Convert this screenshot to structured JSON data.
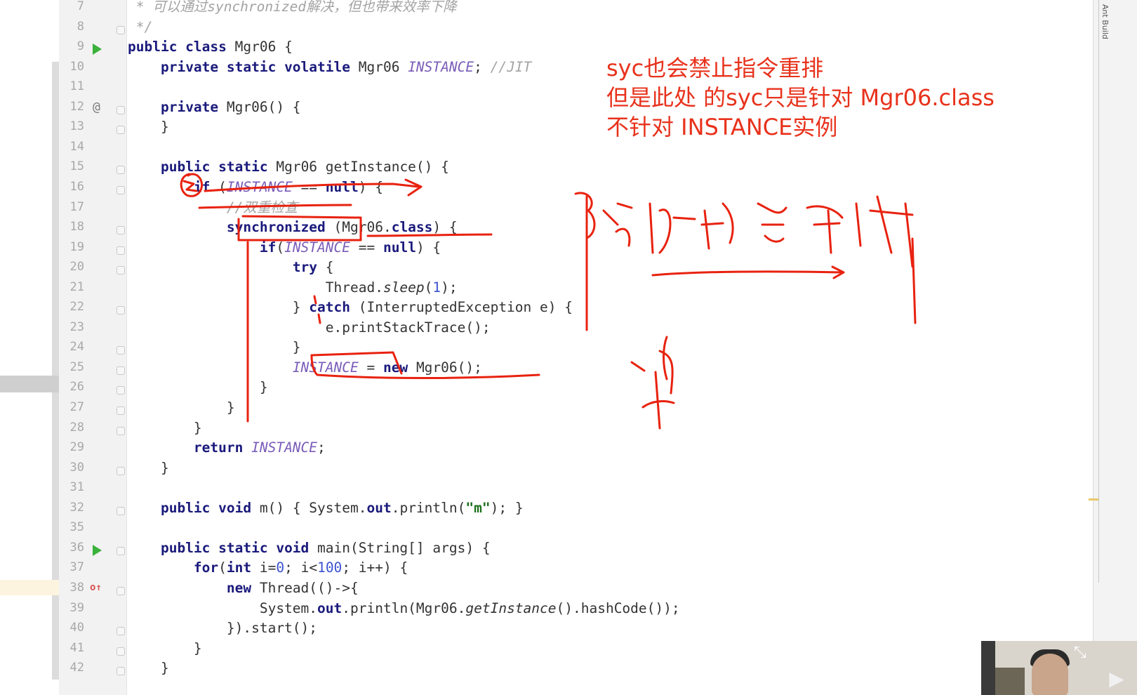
{
  "editor": {
    "lines": [
      {
        "n": "7",
        "segs": [
          [
            "cmt",
            " * 可以通过synchronized解决，但也带来效率下降"
          ]
        ]
      },
      {
        "n": "8",
        "segs": [
          [
            "cmt",
            " */"
          ]
        ]
      },
      {
        "n": "9",
        "segs": [
          [
            "kw",
            "public class "
          ],
          [
            "",
            "Mgr06 {"
          ]
        ]
      },
      {
        "n": "10",
        "segs": [
          [
            "",
            "    "
          ],
          [
            "kw",
            "private static volatile "
          ],
          [
            "",
            "Mgr06 "
          ],
          [
            "inst",
            "INSTANCE"
          ],
          [
            "",
            "; "
          ],
          [
            "cmt",
            "//JIT"
          ]
        ]
      },
      {
        "n": "11",
        "segs": []
      },
      {
        "n": "12",
        "segs": [
          [
            "",
            "    "
          ],
          [
            "kw",
            "private "
          ],
          [
            "",
            "Mgr06() {"
          ]
        ]
      },
      {
        "n": "13",
        "segs": [
          [
            "",
            "    }"
          ]
        ]
      },
      {
        "n": "14",
        "segs": []
      },
      {
        "n": "15",
        "segs": [
          [
            "",
            "    "
          ],
          [
            "kw",
            "public static "
          ],
          [
            "",
            "Mgr06 getInstance() {"
          ]
        ]
      },
      {
        "n": "16",
        "segs": [
          [
            "",
            "        "
          ],
          [
            "kw",
            "if "
          ],
          [
            "",
            "("
          ],
          [
            "inst",
            "INSTANCE"
          ],
          [
            "",
            " == "
          ],
          [
            "kw",
            "null"
          ],
          [
            "",
            ") {"
          ]
        ]
      },
      {
        "n": "17",
        "segs": [
          [
            "cmt",
            "            //双重检查"
          ]
        ]
      },
      {
        "n": "18",
        "segs": [
          [
            "",
            "            "
          ],
          [
            "kw",
            "synchronized "
          ],
          [
            "",
            "(Mgr06."
          ],
          [
            "kw",
            "class"
          ],
          [
            "",
            ") {"
          ]
        ]
      },
      {
        "n": "19",
        "segs": [
          [
            "",
            "                "
          ],
          [
            "kw",
            "if"
          ],
          [
            "",
            "("
          ],
          [
            "inst",
            "INSTANCE"
          ],
          [
            "",
            " == "
          ],
          [
            "kw",
            "null"
          ],
          [
            "",
            ") {"
          ]
        ]
      },
      {
        "n": "20",
        "segs": [
          [
            "",
            "                    "
          ],
          [
            "kw",
            "try "
          ],
          [
            "",
            "{"
          ]
        ]
      },
      {
        "n": "21",
        "segs": [
          [
            "",
            "                        Thread."
          ],
          [
            "method-it",
            "sleep"
          ],
          [
            "",
            "("
          ],
          [
            "num",
            "1"
          ],
          [
            "",
            ");"
          ]
        ]
      },
      {
        "n": "22",
        "segs": [
          [
            "",
            "                    } "
          ],
          [
            "kw",
            "catch "
          ],
          [
            "",
            "(InterruptedException e) {"
          ]
        ]
      },
      {
        "n": "23",
        "segs": [
          [
            "",
            "                        e.printStackTrace();"
          ]
        ]
      },
      {
        "n": "24",
        "segs": [
          [
            "",
            "                    }"
          ]
        ]
      },
      {
        "n": "25",
        "segs": [
          [
            "",
            "                    "
          ],
          [
            "inst",
            "INSTANCE"
          ],
          [
            "",
            " = "
          ],
          [
            "kw",
            "new "
          ],
          [
            "",
            "Mgr06();"
          ]
        ]
      },
      {
        "n": "26",
        "segs": [
          [
            "",
            "                }"
          ]
        ]
      },
      {
        "n": "27",
        "segs": [
          [
            "",
            "            }"
          ]
        ]
      },
      {
        "n": "28",
        "segs": [
          [
            "",
            "        }"
          ]
        ]
      },
      {
        "n": "29",
        "segs": [
          [
            "",
            "        "
          ],
          [
            "kw",
            "return "
          ],
          [
            "inst",
            "INSTANCE"
          ],
          [
            "",
            ";"
          ]
        ]
      },
      {
        "n": "30",
        "segs": [
          [
            "",
            "    }"
          ]
        ]
      },
      {
        "n": "31",
        "segs": []
      },
      {
        "n": "32",
        "segs": [
          [
            "",
            "    "
          ],
          [
            "kw",
            "public void "
          ],
          [
            "",
            "m() { System."
          ],
          [
            "kw",
            "out"
          ],
          [
            "",
            ".println("
          ],
          [
            "str",
            "\"m\""
          ],
          [
            "",
            "); }"
          ]
        ]
      },
      {
        "n": "35",
        "segs": []
      },
      {
        "n": "36",
        "segs": [
          [
            "",
            "    "
          ],
          [
            "kw",
            "public static void "
          ],
          [
            "",
            "main(String[] args) {"
          ]
        ]
      },
      {
        "n": "37",
        "segs": [
          [
            "",
            "        "
          ],
          [
            "kw",
            "for"
          ],
          [
            "",
            "("
          ],
          [
            "kw",
            "int "
          ],
          [
            "",
            "i="
          ],
          [
            "num",
            "0"
          ],
          [
            "",
            "; i<"
          ],
          [
            "num",
            "100"
          ],
          [
            "",
            "; i++) {"
          ]
        ]
      },
      {
        "n": "38",
        "segs": [
          [
            "",
            "            "
          ],
          [
            "kw",
            "new "
          ],
          [
            "",
            "Thread(()->{"
          ]
        ]
      },
      {
        "n": "39",
        "segs": [
          [
            "",
            "                System."
          ],
          [
            "kw",
            "out"
          ],
          [
            "",
            ".println(Mgr06."
          ],
          [
            "method-it",
            "getInstance"
          ],
          [
            "",
            "().hashCode());"
          ]
        ]
      },
      {
        "n": "40",
        "segs": [
          [
            "",
            "            }).start();"
          ]
        ]
      },
      {
        "n": "41",
        "segs": [
          [
            "",
            "        }"
          ]
        ]
      },
      {
        "n": "42",
        "segs": [
          [
            "",
            "    }"
          ]
        ]
      }
    ]
  },
  "annotation": {
    "line1": "syc也会禁止指令重排",
    "line2": "但是此处 的syc只是针对 Mgr06.class",
    "line3": "不针对 INSTANCE实例"
  },
  "side_panel": {
    "label": "Ant Build"
  },
  "gutter_icons": {
    "run": "run-icon",
    "override": "at-icon",
    "implemented": "implemented-icon"
  },
  "colors": {
    "annotation": "#e8321c",
    "keyword": "#1a1a7c",
    "static_field": "#7a5cb8",
    "comment": "#a3a3a3",
    "number": "#3b52d1"
  }
}
